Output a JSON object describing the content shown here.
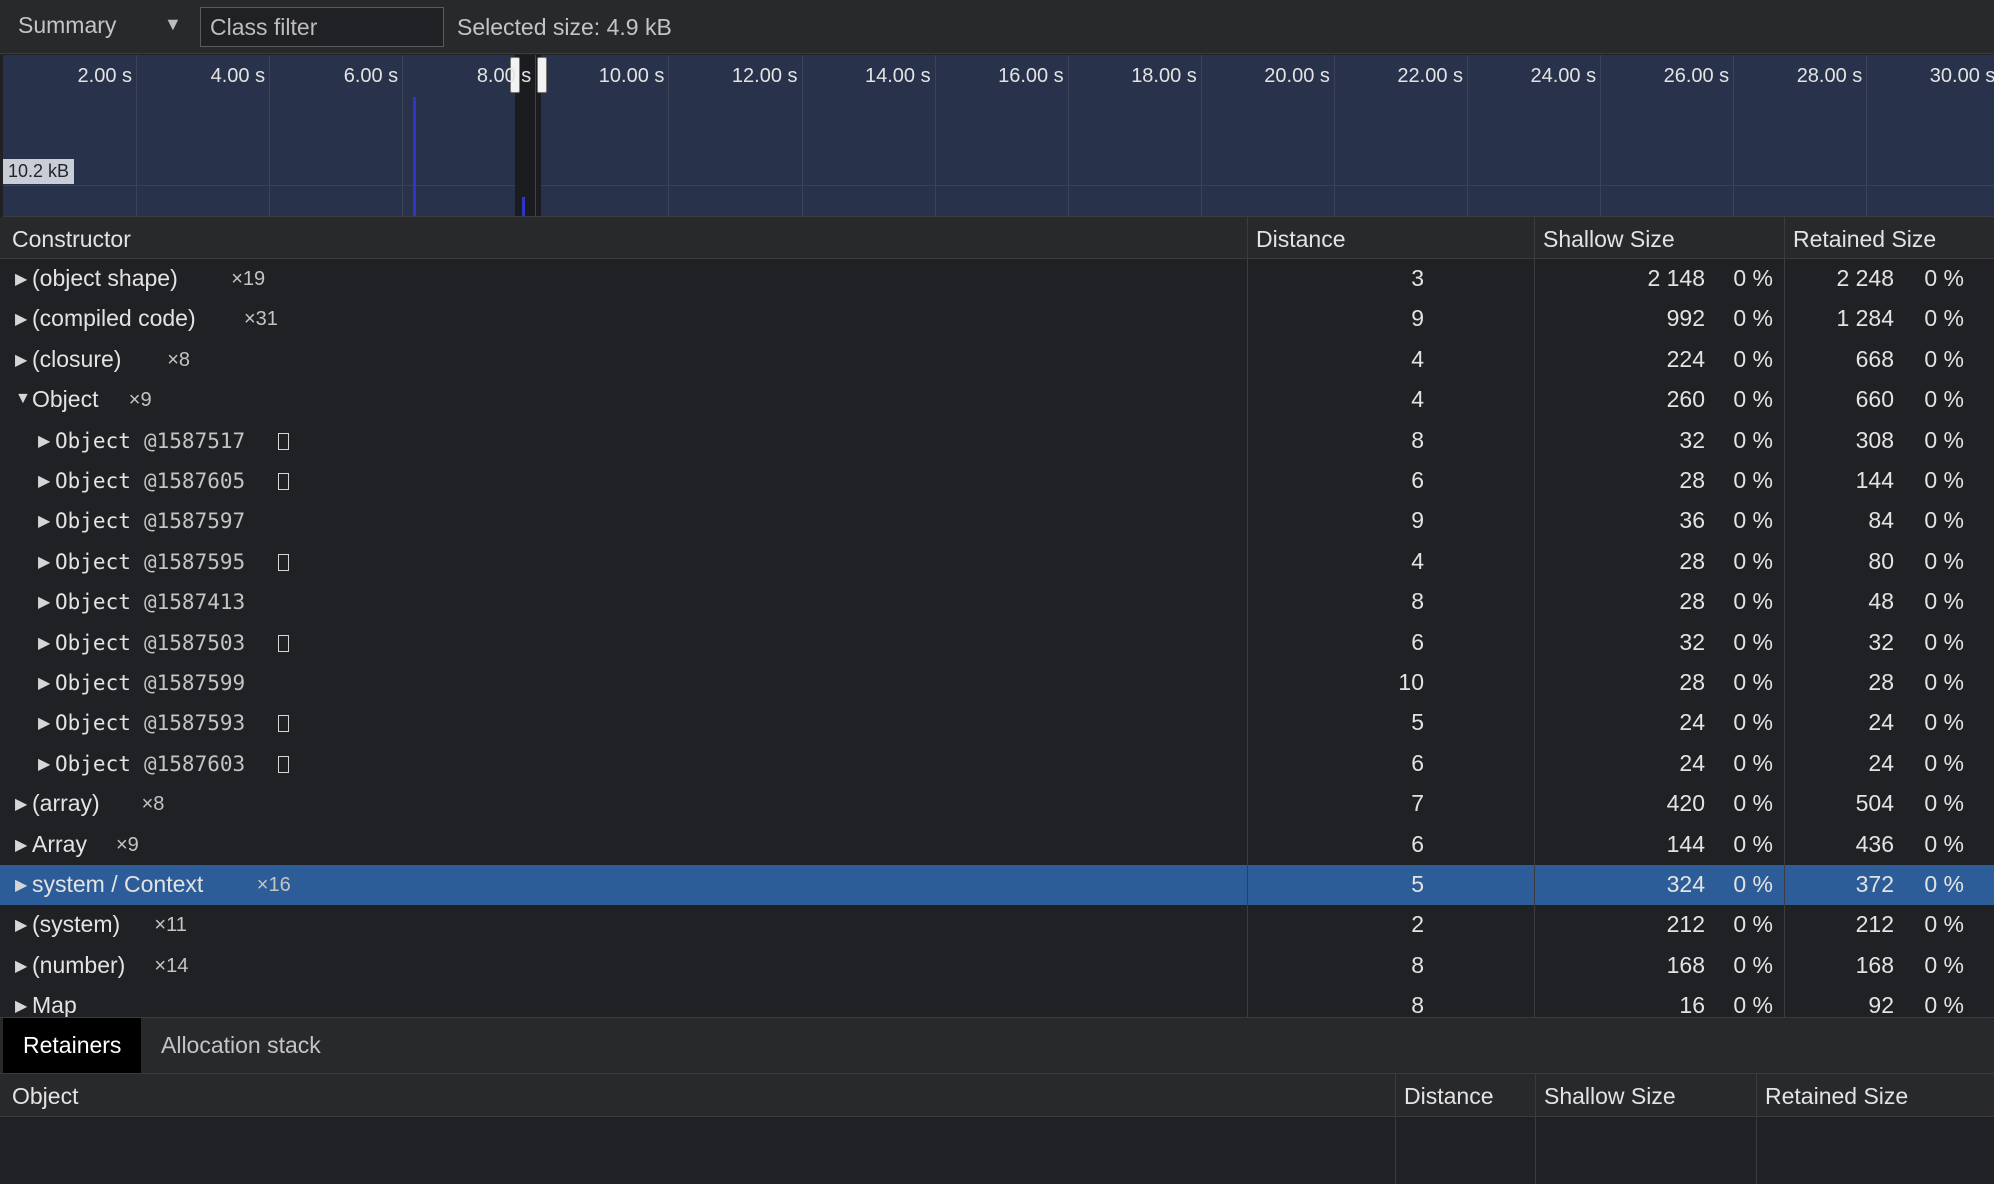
{
  "toolbar": {
    "view": "Summary",
    "class_filter_placeholder": "Class filter",
    "selected_size": "Selected size: 4.9 kB"
  },
  "timeline": {
    "ticks": [
      "2.00 s",
      "4.00 s",
      "6.00 s",
      "8.00 s",
      "10.00 s",
      "12.00 s",
      "14.00 s",
      "16.00 s",
      "18.00 s",
      "20.00 s",
      "22.00 s",
      "24.00 s",
      "26.00 s",
      "28.00 s",
      "30.00 s"
    ],
    "memory_label": "10.2 kB"
  },
  "columns": {
    "constructor": "Constructor",
    "distance": "Distance",
    "shallow": "Shallow Size",
    "retained": "Retained Size"
  },
  "rows": [
    {
      "name": "(object shape)",
      "count": "×19",
      "distance": "3",
      "shallow": "2 148",
      "shallow_pct": "0 %",
      "retained": "2 248",
      "retained_pct": "0 %",
      "expanded": false,
      "child": false
    },
    {
      "name": "(compiled code)",
      "count": "×31",
      "distance": "9",
      "shallow": "992",
      "shallow_pct": "0 %",
      "retained": "1 284",
      "retained_pct": "0 %",
      "expanded": false,
      "child": false
    },
    {
      "name": "(closure)",
      "count": "×8",
      "distance": "4",
      "shallow": "224",
      "shallow_pct": "0 %",
      "retained": "668",
      "retained_pct": "0 %",
      "expanded": false,
      "child": false
    },
    {
      "name": "Object",
      "count": "×9",
      "distance": "4",
      "shallow": "260",
      "shallow_pct": "0 %",
      "retained": "660",
      "retained_pct": "0 %",
      "expanded": true,
      "child": false
    },
    {
      "name": "Object",
      "id": "@1587517",
      "box": true,
      "distance": "8",
      "shallow": "32",
      "shallow_pct": "0 %",
      "retained": "308",
      "retained_pct": "0 %",
      "child": true
    },
    {
      "name": "Object",
      "id": "@1587605",
      "box": true,
      "distance": "6",
      "shallow": "28",
      "shallow_pct": "0 %",
      "retained": "144",
      "retained_pct": "0 %",
      "child": true
    },
    {
      "name": "Object",
      "id": "@1587597",
      "box": false,
      "distance": "9",
      "shallow": "36",
      "shallow_pct": "0 %",
      "retained": "84",
      "retained_pct": "0 %",
      "child": true
    },
    {
      "name": "Object",
      "id": "@1587595",
      "box": true,
      "distance": "4",
      "shallow": "28",
      "shallow_pct": "0 %",
      "retained": "80",
      "retained_pct": "0 %",
      "child": true
    },
    {
      "name": "Object",
      "id": "@1587413",
      "box": false,
      "distance": "8",
      "shallow": "28",
      "shallow_pct": "0 %",
      "retained": "48",
      "retained_pct": "0 %",
      "child": true
    },
    {
      "name": "Object",
      "id": "@1587503",
      "box": true,
      "distance": "6",
      "shallow": "32",
      "shallow_pct": "0 %",
      "retained": "32",
      "retained_pct": "0 %",
      "child": true
    },
    {
      "name": "Object",
      "id": "@1587599",
      "box": false,
      "distance": "10",
      "shallow": "28",
      "shallow_pct": "0 %",
      "retained": "28",
      "retained_pct": "0 %",
      "child": true
    },
    {
      "name": "Object",
      "id": "@1587593",
      "box": true,
      "distance": "5",
      "shallow": "24",
      "shallow_pct": "0 %",
      "retained": "24",
      "retained_pct": "0 %",
      "child": true
    },
    {
      "name": "Object",
      "id": "@1587603",
      "box": true,
      "distance": "6",
      "shallow": "24",
      "shallow_pct": "0 %",
      "retained": "24",
      "retained_pct": "0 %",
      "child": true
    },
    {
      "name": "(array)",
      "count": "×8",
      "distance": "7",
      "shallow": "420",
      "shallow_pct": "0 %",
      "retained": "504",
      "retained_pct": "0 %",
      "expanded": false,
      "child": false
    },
    {
      "name": "Array",
      "count": "×9",
      "distance": "6",
      "shallow": "144",
      "shallow_pct": "0 %",
      "retained": "436",
      "retained_pct": "0 %",
      "expanded": false,
      "child": false
    },
    {
      "name": "system / Context",
      "count": "×16",
      "distance": "5",
      "shallow": "324",
      "shallow_pct": "0 %",
      "retained": "372",
      "retained_pct": "0 %",
      "expanded": false,
      "child": false,
      "selected": true
    },
    {
      "name": "(system)",
      "count": "×11",
      "distance": "2",
      "shallow": "212",
      "shallow_pct": "0 %",
      "retained": "212",
      "retained_pct": "0 %",
      "expanded": false,
      "child": false
    },
    {
      "name": "(number)",
      "count": "×14",
      "distance": "8",
      "shallow": "168",
      "shallow_pct": "0 %",
      "retained": "168",
      "retained_pct": "0 %",
      "expanded": false,
      "child": false
    },
    {
      "name": "Map",
      "count": "",
      "distance": "8",
      "shallow": "16",
      "shallow_pct": "0 %",
      "retained": "92",
      "retained_pct": "0 %",
      "expanded": false,
      "child": false
    }
  ],
  "bottom_tabs": {
    "retainers": "Retainers",
    "allocation_stack": "Allocation stack"
  },
  "retainers_columns": {
    "object": "Object",
    "distance": "Distance",
    "shallow": "Shallow Size",
    "retained": "Retained Size"
  }
}
